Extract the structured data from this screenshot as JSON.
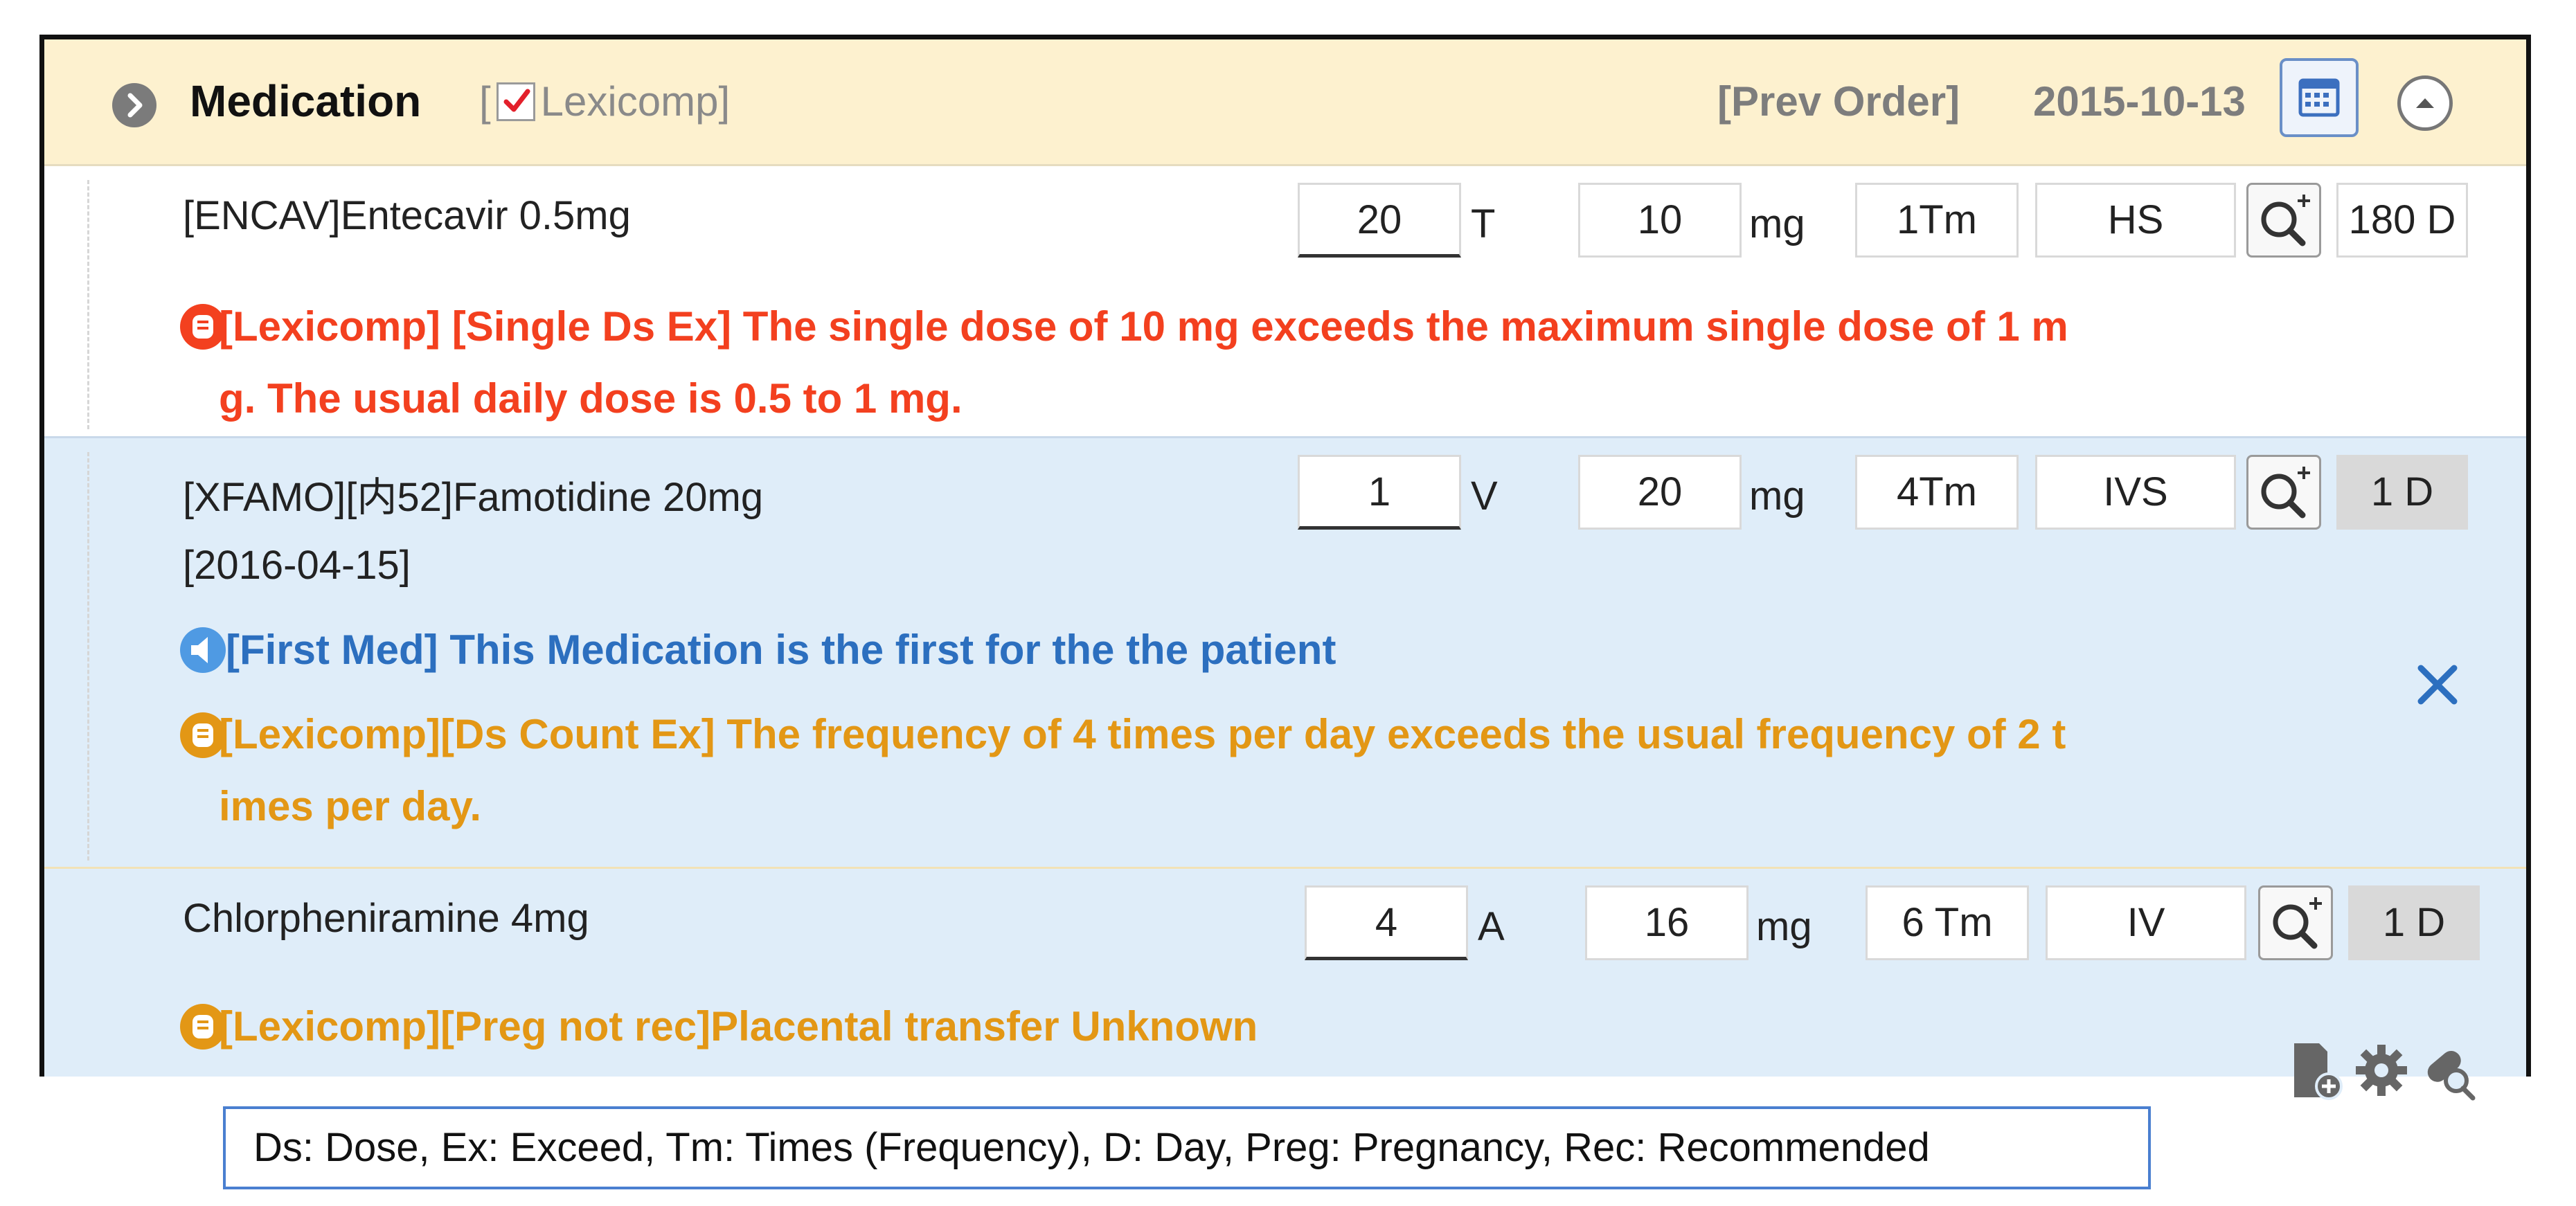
{
  "header": {
    "title": "Medication",
    "lexicomp_prefix": "[",
    "lexicomp_label": "Lexicomp]",
    "prev_order": "[Prev Order]",
    "date": "2015-10-13"
  },
  "orders": [
    {
      "name": "[ENCAV]Entecavir 0.5mg",
      "qty": "20",
      "qty_unit": "T",
      "dose": "10",
      "dose_unit": "mg",
      "freq": "1Tm",
      "route": "HS",
      "days": "180 D",
      "alerts": [
        {
          "kind": "red",
          "line1": "[Lexicomp]  [Single Ds Ex]  The single dose of 10 mg exceeds the maximum single dose of 1 m",
          "line2": "g.  The usual daily dose is 0.5 to 1 mg."
        }
      ]
    },
    {
      "name": "[XFAMO][内52]Famotidine 20mg",
      "sub": "[2016-04-15]",
      "qty": "1",
      "qty_unit": "V",
      "dose": "20",
      "dose_unit": "mg",
      "freq": "4Tm",
      "route": "IVS",
      "days": "1  D",
      "alerts": [
        {
          "kind": "blue",
          "line1": "[First Med] This Medication is the first for the the patient"
        },
        {
          "kind": "orange",
          "line1": "[Lexicomp][Ds Count Ex] The frequency of 4 times per day exceeds the usual frequency of 2 t",
          "line2": "imes per day."
        }
      ]
    },
    {
      "name": "Chlorpheniramine 4mg",
      "qty": "4",
      "qty_unit": "A",
      "dose": "16",
      "dose_unit": "mg",
      "freq": "6 Tm",
      "route": "IV",
      "days": "1  D",
      "alerts": [
        {
          "kind": "orange",
          "line1": "[Lexicomp][Preg  not rec]Placental transfer Unknown"
        }
      ]
    }
  ],
  "legend": "Ds: Dose, Ex: Exceed, Tm: Times (Frequency), D: Day, Preg: Pregnancy, Rec: Recommended",
  "icons": {
    "expand": "chevron-right-icon",
    "lexicomp_check": "checkbox-checked-icon",
    "calendar": "calendar-icon",
    "collapse": "chevron-up-icon",
    "search": "zoom-in-icon",
    "close": "close-icon",
    "add_document": "document-add-icon",
    "settings": "gear-icon",
    "drug_search": "pill-search-icon"
  },
  "colors": {
    "header_bg": "#fdf1cf",
    "row_selected_bg": "#dfedf9",
    "alert_red": "#f3401f",
    "alert_orange": "#e39715",
    "alert_blue": "#2c6fbf",
    "legend_border": "#4a7fd0"
  }
}
